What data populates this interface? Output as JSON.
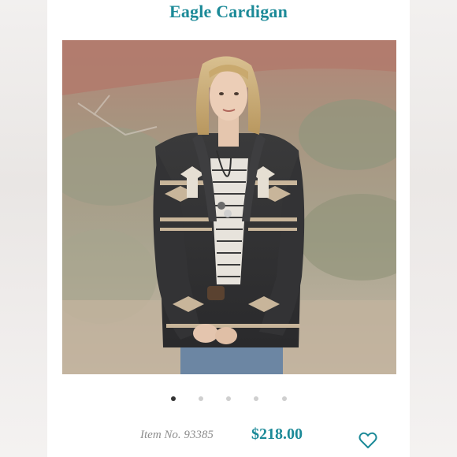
{
  "product": {
    "title": "Eagle Cardigan",
    "image_icon": "product-photo-woman-cardigan",
    "item_number": "Item No. 93385",
    "price": "$218.00"
  },
  "carousel": {
    "count": 5,
    "active_index": 0
  },
  "icons": {
    "favorite": "heart-outline-icon"
  },
  "colors": {
    "accent": "#1c8a98",
    "muted_text": "#8e8e8e",
    "dot_active": "#333333",
    "dot_inactive": "#cfcfcf"
  }
}
